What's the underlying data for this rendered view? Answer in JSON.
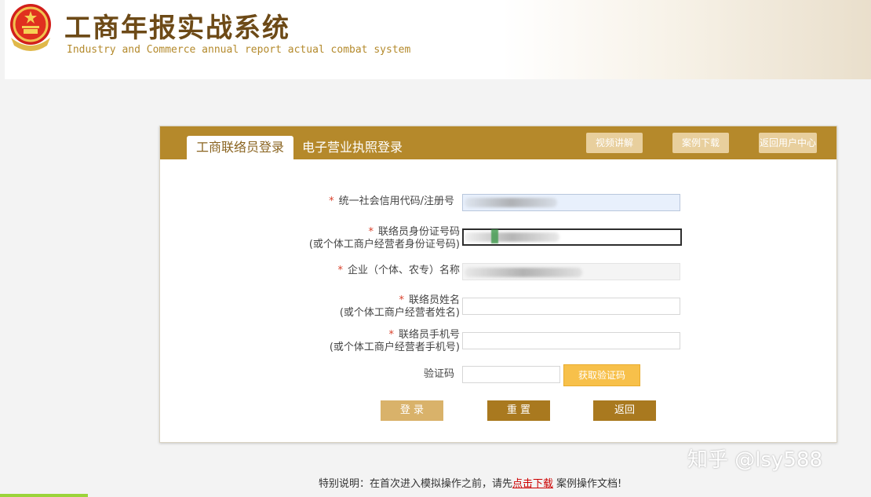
{
  "header": {
    "title": "工商年报实战系统",
    "subtitle": "Industry and Commerce annual report actual combat system",
    "logo_icon": "national-emblem-icon"
  },
  "panel": {
    "tabs": [
      {
        "label": "工商联络员登录",
        "active": true
      },
      {
        "label": "电子营业执照登录",
        "active": false
      }
    ],
    "buttons": {
      "video": "视频讲解",
      "case_download": "案例下载",
      "back_user_center": "返回用户中心"
    }
  },
  "form": {
    "credit_code": {
      "label": "统一社会信用代码/注册号",
      "required": true
    },
    "contact_id": {
      "label": "联络员身份证号码",
      "sublabel": "(或个体工商户经营者身份证号码)",
      "required": true
    },
    "company_name": {
      "label": "企业（个体、农专）名称",
      "required": true
    },
    "contact_name": {
      "label": "联络员姓名",
      "sublabel": "(或个体工商户经营者姓名)",
      "required": true
    },
    "contact_phone": {
      "label": "联络员手机号",
      "sublabel": "(或个体工商户经营者手机号)",
      "required": true
    },
    "captcha": {
      "label": "验证码",
      "required": false
    },
    "required_mark": "*",
    "get_code_button": "获取验证码",
    "login_button": "登 录",
    "reset_button": "重 置",
    "back_button": "返回"
  },
  "footer": {
    "note_before": "特别说明：在首次进入模拟操作之前，请先",
    "link": "点击下载",
    "note_after": "案例操作文档!"
  },
  "watermark": "知乎 @lsy588",
  "colors": {
    "brand_gold": "#b5892b",
    "light_gold": "#e8cf9d",
    "login_btn": "#d9b26a",
    "dark_gold": "#a9791f",
    "sms_orange": "#f7c04a",
    "required_red": "#d9402a",
    "link_red": "#cc0000"
  }
}
